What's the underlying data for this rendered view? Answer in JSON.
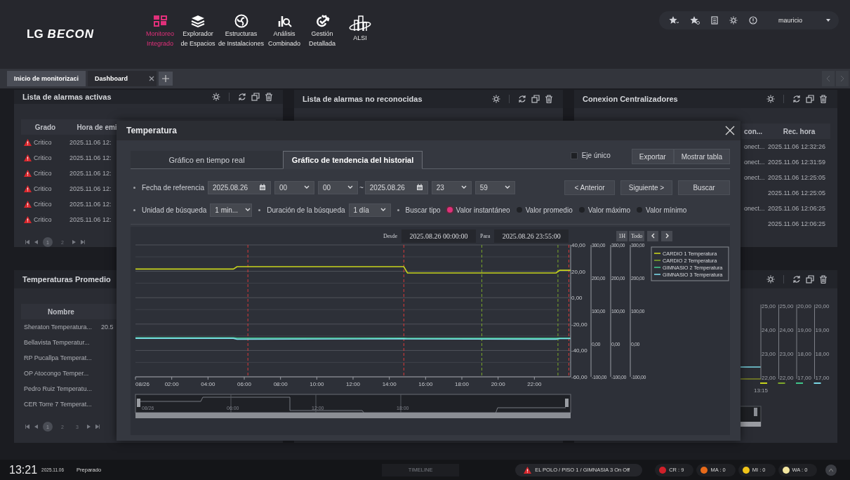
{
  "header": {
    "logo": {
      "brand": "LG",
      "product": "BECON"
    },
    "nav": [
      {
        "lines": [
          "Monitoreo",
          "Integrado"
        ],
        "selected": true
      },
      {
        "lines": [
          "Explorador",
          "de Espacios"
        ],
        "selected": false
      },
      {
        "lines": [
          "Estructuras",
          "de Instalaciones"
        ],
        "selected": false
      },
      {
        "lines": [
          "Análisis",
          "Combinado"
        ],
        "selected": false
      },
      {
        "lines": [
          "Gestión",
          "Detallada"
        ],
        "selected": false
      },
      {
        "lines": [
          "ALSI"
        ],
        "selected": false
      }
    ],
    "user": "mauricio"
  },
  "tabs": [
    {
      "label": "Inicio de monitorizaci",
      "selected": false,
      "closable": false
    },
    {
      "label": "Dashboard",
      "selected": true,
      "closable": true
    }
  ],
  "panels": [
    {
      "kind": "table",
      "tools": true,
      "title": "Lista de alarmas activas",
      "table": {
        "columns": [
          "Grado",
          "Hora de emi"
        ],
        "rows": [
          {
            "alarm": true,
            "cells": [
              "Critico",
              "2025.11.06 12:"
            ]
          },
          {
            "alarm": true,
            "cells": [
              "Critico",
              "2025.11.06 12:"
            ]
          },
          {
            "alarm": true,
            "cells": [
              "Critico",
              "2025.11.06 12:"
            ]
          },
          {
            "alarm": true,
            "cells": [
              "Critico",
              "2025.11.06 12:"
            ]
          },
          {
            "alarm": true,
            "cells": [
              "Critico",
              "2025.11.06 12:"
            ]
          },
          {
            "alarm": true,
            "cells": [
              "Critico",
              "2025.11.06 12:"
            ]
          }
        ]
      },
      "pages": [
        {
          "label": "1",
          "selected": true
        },
        {
          "label": "2",
          "selected": false
        }
      ]
    },
    {
      "kind": "titled",
      "tools": true,
      "title": "Lista de alarmas no reconocidas"
    },
    {
      "kind": "table",
      "tools": true,
      "title": "Conexion Centralizadores",
      "table": {
        "columns": [
          "con...",
          "Rec. hora"
        ],
        "rows": [
          {
            "alarm": false,
            "cells": [
              "onect...",
              "2025.11.06 12:32:26"
            ]
          },
          {
            "alarm": false,
            "cells": [
              "onect...",
              "2025.11.06 12:31:59"
            ]
          },
          {
            "alarm": false,
            "cells": [
              "onect...",
              "2025.11.06 12:25:05"
            ]
          },
          {
            "alarm": false,
            "cells": [
              "",
              "2025.11.06 12:25:05"
            ]
          },
          {
            "alarm": false,
            "cells": [
              "onect...",
              "2025.11.06 12:06:25"
            ]
          },
          {
            "alarm": false,
            "cells": [
              "",
              "2025.11.06 12:06:25"
            ]
          }
        ]
      }
    },
    {
      "kind": "table",
      "title": "Temperaturas Promedio",
      "table": {
        "columns": [
          "Nombre",
          ""
        ],
        "rows": [
          {
            "alarm": false,
            "cells": [
              "Sheraton Temperatura...",
              "20.5"
            ]
          },
          {
            "alarm": false,
            "cells": [
              "Bellavista Temperatur...",
              ""
            ]
          },
          {
            "alarm": false,
            "cells": [
              "RP Pucallpa Temperat...",
              ""
            ]
          },
          {
            "alarm": false,
            "cells": [
              "OP Atocongo Temper...",
              ""
            ]
          },
          {
            "alarm": false,
            "cells": [
              "Pedro Ruiz Temperatu...",
              ""
            ]
          },
          {
            "alarm": false,
            "cells": [
              "CER Torre 7 Temperat...",
              ""
            ]
          }
        ]
      },
      "pages": [
        {
          "label": "1",
          "selected": true
        },
        {
          "label": "2",
          "selected": false
        },
        {
          "label": "3",
          "selected": false
        }
      ]
    },
    {
      "kind": "empty"
    },
    {
      "kind": "chart",
      "tools": true,
      "mini_chart": {
        "axes": [
          {
            "ticks": [
              "25,00",
              "24,00",
              "23,00",
              "22,00"
            ],
            "color": "#c8d41c"
          },
          {
            "ticks": [
              "25,00",
              "24,00",
              "23,00",
              "22,00"
            ],
            "color": "#7fa82a"
          },
          {
            "ticks": [
              "20,00",
              "19,00",
              "18,00",
              "17,00"
            ],
            "color": "#3fc58a"
          },
          {
            "ticks": [
              "20,00",
              "19,00",
              "18,00",
              "17,00"
            ],
            "color": "#7ad8e6"
          }
        ],
        "x_label": "13:15"
      }
    }
  ],
  "dialog": {
    "title": "Temperatura",
    "tabs": [
      {
        "label": "Gráfico en tiempo real",
        "selected": false
      },
      {
        "label": "Gráfico de tendencia del historial",
        "selected": true
      }
    ],
    "single_axis": {
      "label": "Eje único",
      "checked": false
    },
    "buttons": [
      "Exportar",
      "Mostrar tabla"
    ],
    "reference": {
      "label": "Fecha de referencia",
      "from_date": "2025.08.26",
      "from_hour": "00",
      "from_minute": "00",
      "separator": "~",
      "to_date": "2025.08.26",
      "to_hour": "23",
      "to_minute": "59"
    },
    "nav_buttons": [
      "< Anterior",
      "Siguiente >",
      "Buscar"
    ],
    "unit": {
      "label": "Unidad de búsqueda",
      "value": "1 min..."
    },
    "duration": {
      "label": "Duración de la búsqueda",
      "value": "1 día"
    },
    "search_type": {
      "label": "Buscar tipo",
      "options": [
        {
          "label": "Valor instantáneo",
          "selected": true
        },
        {
          "label": "Valor promedio",
          "selected": false
        },
        {
          "label": "Valor máximo",
          "selected": false
        },
        {
          "label": "Valor mínimo",
          "selected": false
        }
      ]
    },
    "range": {
      "from_label": "Desde",
      "from": "2025.08.26 00:00:00",
      "to_label": "Para",
      "to": "2025.08.26 23:55:00",
      "buttons": [
        "1H",
        "Todo"
      ]
    },
    "chart_data": {
      "type": "line",
      "grid": true,
      "legend": "right",
      "x": [
        0,
        5.4,
        5.6,
        14.8,
        15,
        23.2,
        23.4,
        24
      ],
      "xlim": [
        0,
        24
      ],
      "ylim": [
        -60,
        40
      ],
      "xticks": [
        {
          "value": 0,
          "label": "08/26"
        },
        {
          "value": 2,
          "label": "02:00"
        },
        {
          "value": 4,
          "label": "04:00"
        },
        {
          "value": 6,
          "label": "06:00"
        },
        {
          "value": 8,
          "label": "08:00"
        },
        {
          "value": 10,
          "label": "10:00"
        },
        {
          "value": 12,
          "label": "12:00"
        },
        {
          "value": 14,
          "label": "14:00"
        },
        {
          "value": 16,
          "label": "16:00"
        },
        {
          "value": 18,
          "label": "18:00"
        },
        {
          "value": 20,
          "label": "20:00"
        },
        {
          "value": 22,
          "label": "22:00"
        }
      ],
      "yticks": [
        {
          "value": 40,
          "label": "40,00"
        },
        {
          "value": 20,
          "label": "20,00"
        },
        {
          "value": 0,
          "label": "0,00"
        },
        {
          "value": -20,
          "label": "-20,00"
        },
        {
          "value": -40,
          "label": "-40,00"
        },
        {
          "value": -60,
          "label": "-60,00"
        }
      ],
      "series": [
        {
          "name": "CARDIO 1 Temperatura",
          "color": "#c8d41c",
          "values": [
            21.7,
            21.7,
            23.5,
            23.5,
            18.7,
            18.7,
            20.8,
            20.8
          ]
        },
        {
          "name": "CARDIO 2 Temperatura",
          "color": "#7fa82a",
          "values": [
            null,
            null,
            null,
            null,
            null,
            null,
            null,
            null
          ]
        },
        {
          "name": "GIMNASIO 2 Temperatura",
          "color": "#3fc58a",
          "values": [
            -30.3,
            -30.3,
            -30.6,
            -30.6,
            -30.8,
            -30.8,
            -30.6,
            -30.6
          ]
        },
        {
          "name": "GIMNASIO 3 Temperatura",
          "color": "#7ad8e6",
          "values": [
            -30.8,
            -30.8,
            -31.5,
            -31.2,
            -31.3,
            -31.5,
            -31,
            -31
          ]
        }
      ],
      "ref_lines": [
        {
          "axis": "x",
          "value": 6.2,
          "color": "#d83a3a"
        },
        {
          "axis": "x",
          "value": 14.8,
          "color": "#d83a3a"
        },
        {
          "axis": "x",
          "value": 19.1,
          "color": "#7aa82a"
        },
        {
          "axis": "x",
          "value": 23.3,
          "color": "#7aa82a"
        },
        {
          "axis": "x",
          "value": 23.9,
          "color": "#d83a3a"
        }
      ]
    },
    "secondary_axes": [
      {
        "ticks": [
          "300,00",
          "200,00",
          "100,00",
          "0,00",
          "-100,00"
        ]
      },
      {
        "ticks": [
          "300,00",
          "200,00",
          "100,00",
          "0,00",
          "-100,00"
        ]
      },
      {
        "ticks": [
          "300,00",
          "200,00",
          "100,00",
          "0,00",
          "-100,00"
        ]
      }
    ],
    "navigator": {
      "labels": [
        "08/26",
        "06:00",
        "12:00",
        "18:00"
      ]
    }
  },
  "status_bar": {
    "time": "13:21",
    "date": "2025.11.06",
    "state": "Preparado",
    "timeline": "TIMELINE",
    "alarm": "EL POLO / PISO 1 / GIMNASIA 3 On Off",
    "counters": [
      {
        "label": "CR : 9",
        "color": "#d0202a"
      },
      {
        "label": "MA : 0",
        "color": "#e86a1a"
      },
      {
        "label": "MI : 0",
        "color": "#f0c419"
      },
      {
        "label": "WA : 0",
        "color": "#f3e6a0"
      }
    ]
  }
}
